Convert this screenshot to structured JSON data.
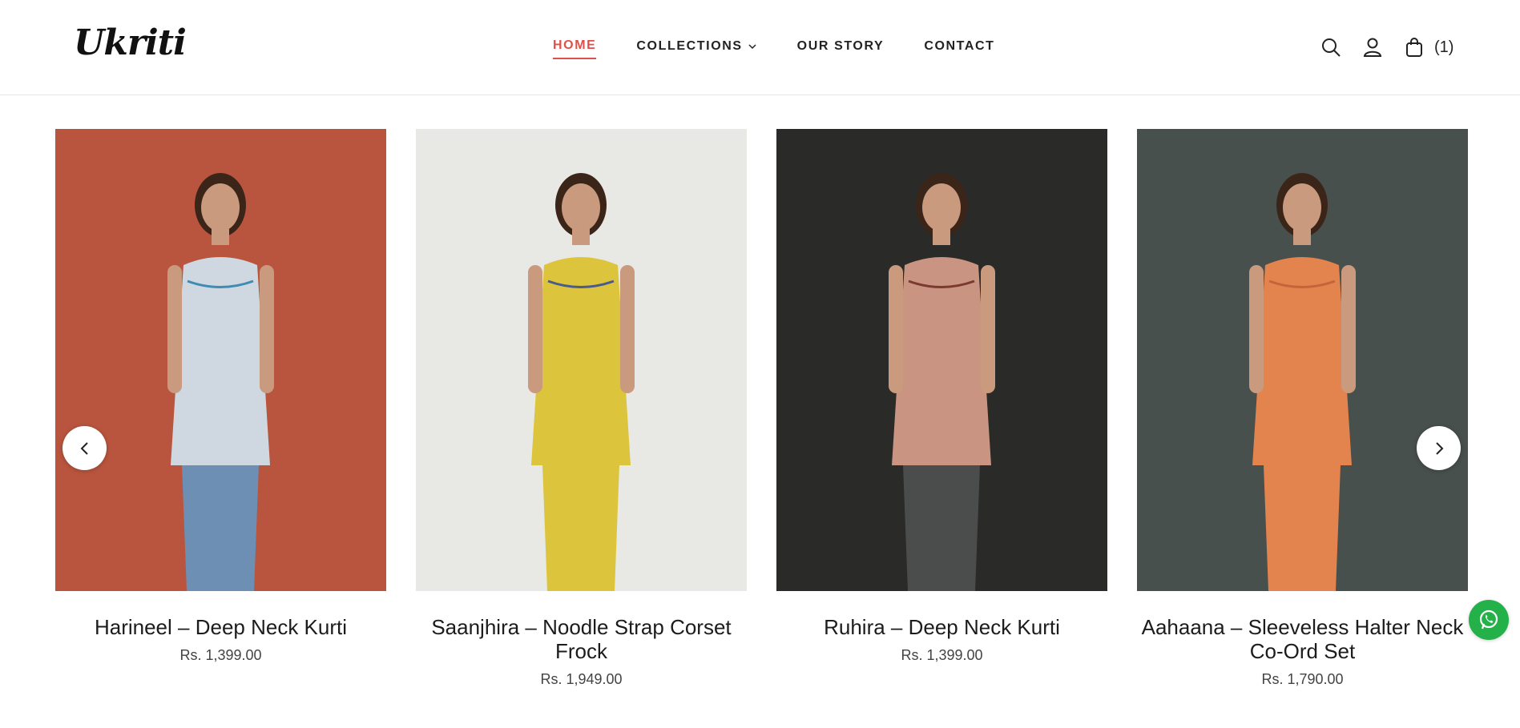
{
  "brand": {
    "logo_text": "Ukriti"
  },
  "nav": {
    "items": [
      {
        "label": "HOME",
        "active": true
      },
      {
        "label": "COLLECTIONS",
        "has_dropdown": true
      },
      {
        "label": "OUR STORY"
      },
      {
        "label": "CONTACT"
      }
    ]
  },
  "header_icons": {
    "search": "search-icon",
    "account": "user-icon",
    "cart": "bag-icon",
    "cart_count": "(1)"
  },
  "products": [
    {
      "title": "Harineel – Deep Neck Kurti",
      "price": "Rs. 1,399.00",
      "bg": "#b9553e",
      "garment": "#cfd8e0",
      "accent": "#3f8bb3",
      "bottoms": "#6d8fb3"
    },
    {
      "title": "Saanjhira – Noodle Strap Corset Frock",
      "price": "Rs. 1,949.00",
      "bg": "#e8e8e4",
      "garment": "#dcc53c",
      "accent": "#4a5a8a",
      "bottoms": "#dcc53c"
    },
    {
      "title": "Ruhira – Deep Neck Kurti",
      "price": "Rs. 1,399.00",
      "bg": "#2a2a28",
      "garment": "#c99582",
      "accent": "#7a3a30",
      "bottoms": "#4a4d4c"
    },
    {
      "title": "Aahaana – Sleeveless Halter Neck Co-Ord Set",
      "price": "Rs. 1,790.00",
      "bg": "#48504d",
      "garment": "#e3834e",
      "accent": "#c4643a",
      "bottoms": "#e3834e"
    }
  ],
  "carousel": {
    "prev": "chevron-left-icon",
    "next": "chevron-right-icon"
  },
  "floating": {
    "whatsapp": "whatsapp-icon"
  },
  "colors": {
    "accent": "#e0504a",
    "whatsapp": "#25b14a"
  }
}
